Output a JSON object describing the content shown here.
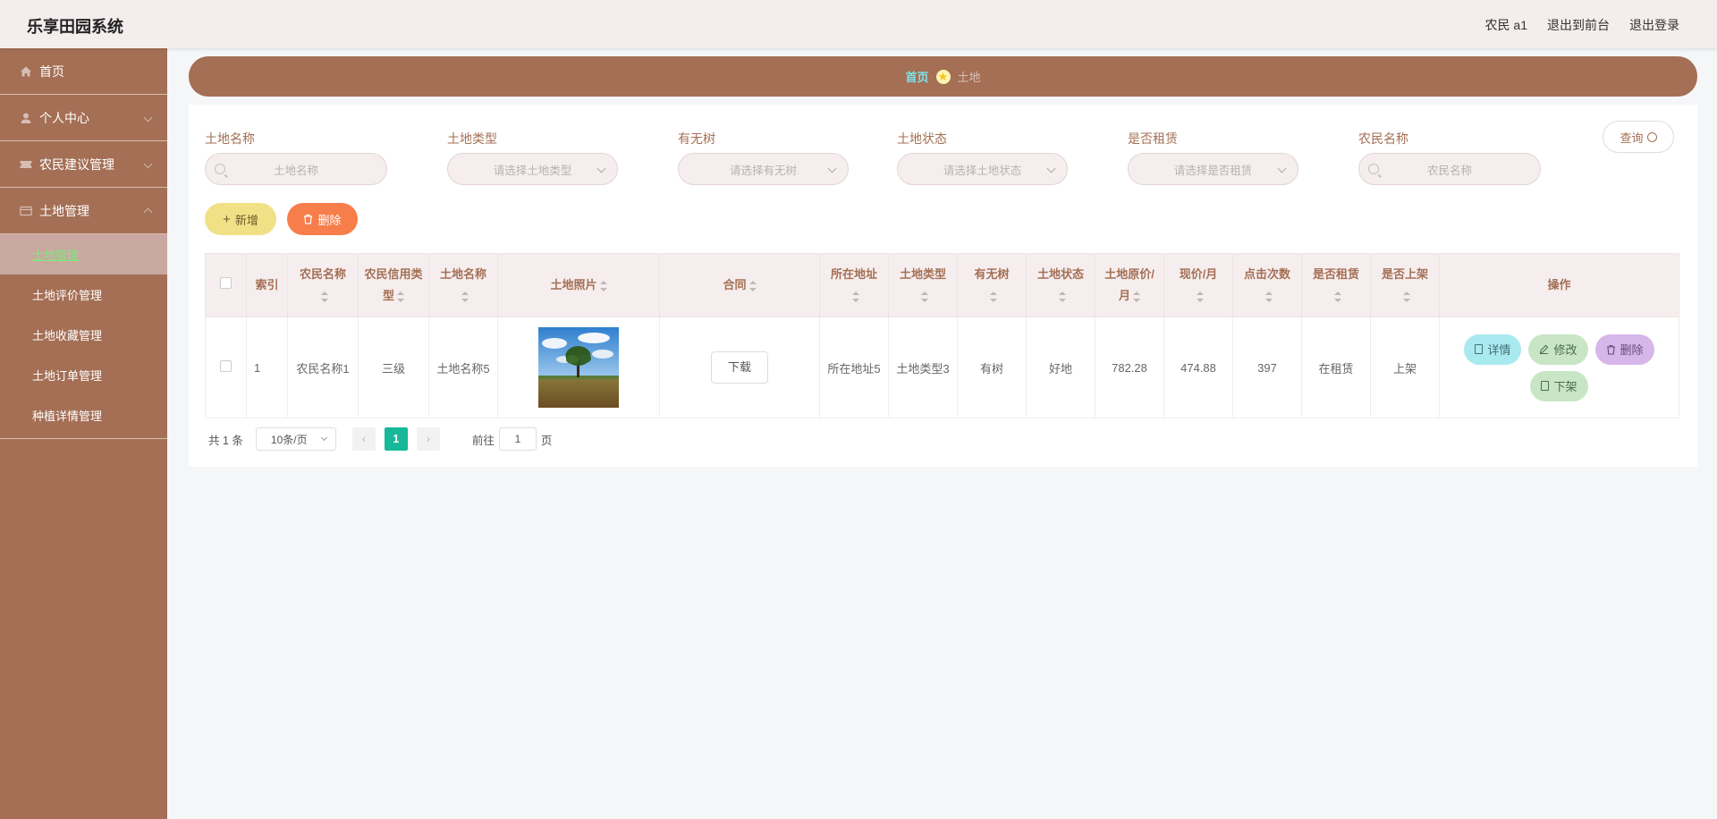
{
  "header": {
    "title": "乐享田园系统",
    "user_label": "农民 a1",
    "to_front_label": "退出到前台",
    "logout_label": "退出登录"
  },
  "sidebar": {
    "items": [
      {
        "label": "首页",
        "icon": "home-icon"
      },
      {
        "label": "个人中心",
        "icon": "user-icon"
      },
      {
        "label": "农民建议管理",
        "icon": "ticket-icon"
      },
      {
        "label": "土地管理",
        "icon": "card-icon"
      }
    ],
    "sub_items": [
      {
        "label": "土地管理",
        "active": true
      },
      {
        "label": "土地评价管理"
      },
      {
        "label": "土地收藏管理"
      },
      {
        "label": "土地订单管理"
      },
      {
        "label": "种植详情管理"
      }
    ]
  },
  "breadcrumb": {
    "home": "首页",
    "current": "土地"
  },
  "filters": {
    "land_name": {
      "label": "土地名称",
      "placeholder": "土地名称"
    },
    "land_type": {
      "label": "土地类型",
      "placeholder": "请选择土地类型"
    },
    "has_tree": {
      "label": "有无树",
      "placeholder": "请选择有无树"
    },
    "land_status": {
      "label": "土地状态",
      "placeholder": "请选择土地状态"
    },
    "is_rented": {
      "label": "是否租赁",
      "placeholder": "请选择是否租赁"
    },
    "farmer_name": {
      "label": "农民名称",
      "placeholder": "农民名称"
    },
    "query_label": "查询"
  },
  "actions": {
    "add_label": "新增",
    "delete_label": "删除"
  },
  "table": {
    "headers": {
      "index": "索引",
      "farmer_name": "农民名称",
      "credit_type": "农民信用类型",
      "land_name": "土地名称",
      "photo": "土地照片",
      "contract": "合同",
      "address": "所在地址",
      "land_type": "土地类型",
      "has_tree": "有无树",
      "land_status": "土地状态",
      "orig_price": "土地原价/月",
      "cur_price": "现价/月",
      "clicks": "点击次数",
      "rented": "是否租赁",
      "listed": "是否上架",
      "ops": "操作"
    },
    "rows": [
      {
        "index": "1",
        "farmer_name": "农民名称1",
        "credit_type": "三级",
        "land_name": "土地名称5",
        "contract_button": "下载",
        "address": "所在地址5",
        "land_type": "土地类型3",
        "has_tree": "有树",
        "land_status": "好地",
        "orig_price": "782.28",
        "cur_price": "474.88",
        "clicks": "397",
        "rented": "在租赁",
        "listed": "上架",
        "op_detail": "详情",
        "op_edit": "修改",
        "op_delete": "删除",
        "op_unlist": "下架"
      }
    ]
  },
  "pagination": {
    "total": "共 1 条",
    "page_size": "10条/页",
    "current_page": "1",
    "goto_prefix": "前往",
    "goto_value": "1",
    "goto_suffix": "页"
  },
  "colors": {
    "brand": "#a46f55",
    "header_bg": "#f5eded",
    "active_page": "#16b89a"
  }
}
